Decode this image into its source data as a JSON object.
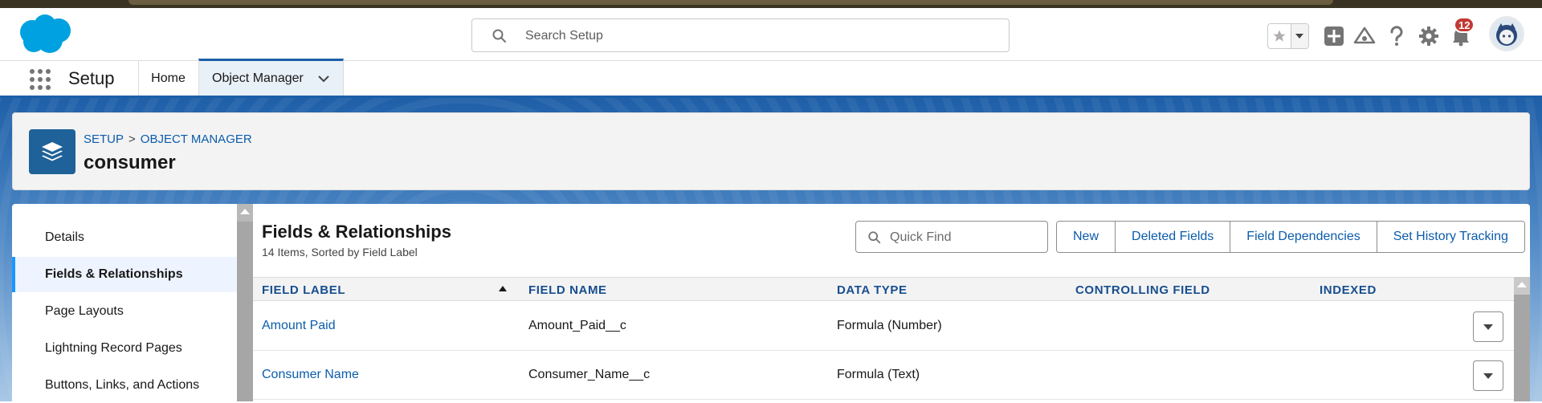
{
  "header": {
    "search_placeholder": "Search Setup",
    "notification_count": "12"
  },
  "nav": {
    "app_name": "Setup",
    "tabs": [
      {
        "label": "Home"
      },
      {
        "label": "Object Manager"
      }
    ]
  },
  "object_header": {
    "breadcrumb": [
      "SETUP",
      "OBJECT MANAGER"
    ],
    "breadcrumb_separator": ">",
    "title": "consumer"
  },
  "sidebar": {
    "items": [
      {
        "label": "Details"
      },
      {
        "label": "Fields & Relationships",
        "active": true
      },
      {
        "label": "Page Layouts"
      },
      {
        "label": "Lightning Record Pages"
      },
      {
        "label": "Buttons, Links, and Actions"
      }
    ]
  },
  "main": {
    "title": "Fields & Relationships",
    "subtitle": "14 Items, Sorted by Field Label",
    "quick_find_placeholder": "Quick Find",
    "buttons": [
      "New",
      "Deleted Fields",
      "Field Dependencies",
      "Set History Tracking"
    ],
    "columns": [
      "FIELD LABEL",
      "FIELD NAME",
      "DATA TYPE",
      "CONTROLLING FIELD",
      "INDEXED"
    ],
    "rows": [
      {
        "field_label": "Amount Paid",
        "field_name": "Amount_Paid__c",
        "data_type": "Formula (Number)",
        "controlling_field": "",
        "indexed": ""
      },
      {
        "field_label": "Consumer Name",
        "field_name": "Consumer_Name__c",
        "data_type": "Formula (Text)",
        "controlling_field": "",
        "indexed": ""
      }
    ]
  },
  "colors": {
    "brand_blue": "#0b5cab",
    "header_accent": "#1b5fa8",
    "object_icon": "#1f6299",
    "badge_red": "#c23934",
    "table_header_text": "#174e8f"
  },
  "icons": [
    "salesforce-logo",
    "search-icon",
    "star-icon",
    "chevron-down-icon",
    "plus-icon",
    "trailhead-icon",
    "help-icon",
    "gear-icon",
    "bell-icon",
    "app-launcher-icon",
    "layers-icon",
    "sort-ascending-icon"
  ]
}
